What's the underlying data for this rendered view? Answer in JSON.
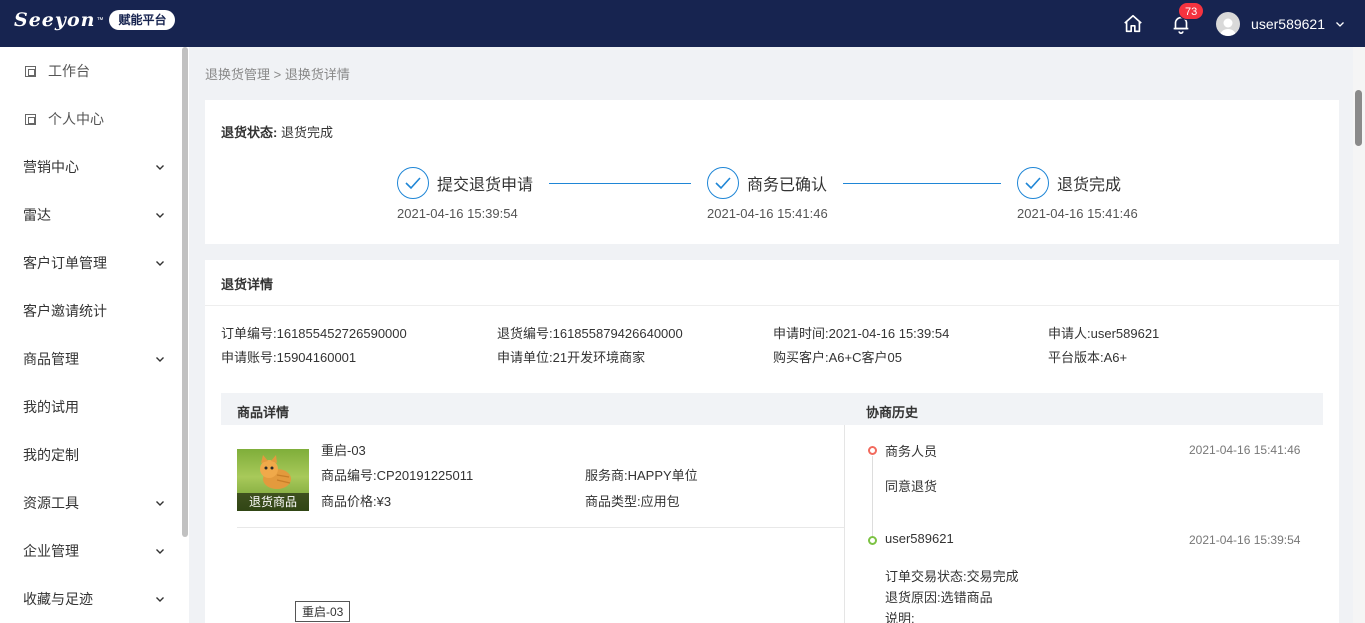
{
  "header": {
    "logo_text": "Seeyon",
    "logo_tm": "™",
    "platform_badge": "赋能平台",
    "notification_count": "73",
    "user_name": "user589621"
  },
  "sidebar": {
    "items": [
      {
        "label": "工作台",
        "has_icon": true
      },
      {
        "label": "个人中心",
        "has_icon": true
      },
      {
        "label": "营销中心",
        "expandable": true
      },
      {
        "label": "雷达",
        "expandable": true
      },
      {
        "label": "客户订单管理",
        "expandable": true
      },
      {
        "label": "客户邀请统计"
      },
      {
        "label": "商品管理",
        "expandable": true
      },
      {
        "label": "我的试用"
      },
      {
        "label": "我的定制"
      },
      {
        "label": "资源工具",
        "expandable": true
      },
      {
        "label": "企业管理",
        "expandable": true
      },
      {
        "label": "收藏与足迹",
        "expandable": true
      }
    ]
  },
  "breadcrumb": {
    "parent": "退换货管理",
    "separator": " > ",
    "current": "退换货详情"
  },
  "status": {
    "key": "退货状态:",
    "value": "退货完成"
  },
  "steps": [
    {
      "label": "提交退货申请",
      "time": "2021-04-16 15:39:54"
    },
    {
      "label": "商务已确认",
      "time": "2021-04-16 15:41:46"
    },
    {
      "label": "退货完成",
      "time": "2021-04-16 15:41:46"
    }
  ],
  "detail": {
    "title": "退货详情",
    "fields": [
      {
        "text": "订单编号:161855452726590000"
      },
      {
        "text": "退货编号:161855879426640000"
      },
      {
        "text": "申请时间:2021-04-16 15:39:54"
      },
      {
        "text": "申请人:user589621"
      },
      {
        "text": "申请账号:15904160001"
      },
      {
        "text": "申请单位:21开发环境商家"
      },
      {
        "text": "购买客户:A6+C客户05"
      },
      {
        "text": "平台版本:A6+"
      }
    ]
  },
  "goods": {
    "section_title": "商品详情",
    "history_title": "协商历史",
    "name": "重启-03",
    "thumb_label": "退货商品",
    "code": "商品编号:CP20191225011",
    "provider": "服务商:HAPPY单位",
    "price": "商品价格:¥3",
    "type": "商品类型:应用包",
    "tag": "重启-03"
  },
  "history": [
    {
      "actor": "商务人员",
      "time": "2021-04-16 15:41:46",
      "lines": [
        "同意退货"
      ],
      "dot_color": "#f26a5d"
    },
    {
      "actor": "user589621",
      "time": "2021-04-16 15:39:54",
      "lines": [
        "订单交易状态:交易完成",
        "退货原因:选错商品",
        "说明:"
      ],
      "dot_color": "#7cc243"
    }
  ],
  "colors": {
    "topbar": "#172450",
    "accent": "#1f86d6"
  }
}
